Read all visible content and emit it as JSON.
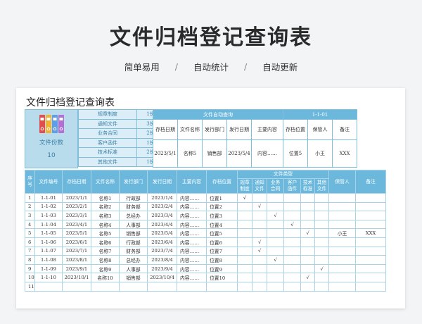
{
  "hero_title": "文件归档登记查询表",
  "subtitle": {
    "items": [
      "简单易用",
      "自动统计",
      "自动更新"
    ],
    "sep": "/"
  },
  "sheet_title": "文件归档登记查询表",
  "count_box": {
    "label": "文件份数",
    "value": "10",
    "binder_colors": [
      "#e04e4e",
      "#f2b233",
      "#5f9ee6",
      "#b46fd6"
    ]
  },
  "categories": [
    {
      "name": "规章制度",
      "count": "1份"
    },
    {
      "name": "通知文件",
      "count": "3份"
    },
    {
      "name": "业务合同",
      "count": "2份"
    },
    {
      "name": "客户函件",
      "count": "1份"
    },
    {
      "name": "技术标准",
      "count": "2份"
    },
    {
      "name": "其他文件",
      "count": "1份"
    }
  ],
  "query": {
    "title": "文件自动查询",
    "key": "1-1-01",
    "headers": [
      "存档日期",
      "文件名称",
      "发行部门",
      "发行日期",
      "主要内容",
      "存档位置",
      "保管人",
      "备注"
    ],
    "values": [
      "2023/5/1",
      "名称5",
      "销售部",
      "2023/5/4",
      "内容……",
      "位置5",
      "小王",
      "XXX"
    ]
  },
  "main": {
    "headers": [
      "序号",
      "文件编号",
      "存档日期",
      "文件名称",
      "发行部门",
      "发行日期",
      "主要内容",
      "存档位置",
      "文件类型",
      "保管人",
      "备注"
    ],
    "type_headers": [
      [
        "规章",
        "制度"
      ],
      [
        "通知",
        "文件"
      ],
      [
        "业务",
        "合同"
      ],
      [
        "客户",
        "函件"
      ],
      [
        "技术",
        "标准"
      ],
      [
        "其他",
        "文件"
      ]
    ],
    "check_mark": "√",
    "rows": [
      {
        "idx": "1",
        "code": "1-1-01",
        "date": "2023/1/1",
        "name": "名称1",
        "dept": "行政部",
        "issue": "2023/1/4",
        "content": "内容……",
        "loc": "位置1",
        "type": 0,
        "keeper": "",
        "note": ""
      },
      {
        "idx": "2",
        "code": "1-1-02",
        "date": "2023/2/1",
        "name": "名称2",
        "dept": "财务部",
        "issue": "2023/2/4",
        "content": "内容……",
        "loc": "位置2",
        "type": 1,
        "keeper": "",
        "note": ""
      },
      {
        "idx": "3",
        "code": "1-1-03",
        "date": "2023/3/1",
        "name": "名称3",
        "dept": "总经办",
        "issue": "2023/3/4",
        "content": "内容……",
        "loc": "位置3",
        "type": 2,
        "keeper": "",
        "note": ""
      },
      {
        "idx": "4",
        "code": "1-1-04",
        "date": "2023/4/1",
        "name": "名称4",
        "dept": "人事部",
        "issue": "2023/4/4",
        "content": "内容……",
        "loc": "位置4",
        "type": 3,
        "keeper": "",
        "note": ""
      },
      {
        "idx": "5",
        "code": "1-1-05",
        "date": "2023/5/1",
        "name": "名称5",
        "dept": "销售部",
        "issue": "2023/5/4",
        "content": "内容……",
        "loc": "位置5",
        "type": 4,
        "keeper": "小王",
        "note": "XXX"
      },
      {
        "idx": "6",
        "code": "1-1-06",
        "date": "2023/6/1",
        "name": "名称6",
        "dept": "行政部",
        "issue": "2023/6/4",
        "content": "内容……",
        "loc": "位置6",
        "type": 1,
        "keeper": "",
        "note": ""
      },
      {
        "idx": "7",
        "code": "1-1-07",
        "date": "2023/7/1",
        "name": "名称7",
        "dept": "财务部",
        "issue": "2023/7/4",
        "content": "内容……",
        "loc": "位置7",
        "type": 1,
        "keeper": "",
        "note": ""
      },
      {
        "idx": "8",
        "code": "1-1-08",
        "date": "2023/8/1",
        "name": "名称8",
        "dept": "总经办",
        "issue": "2023/8/4",
        "content": "内容……",
        "loc": "位置8",
        "type": 2,
        "keeper": "",
        "note": ""
      },
      {
        "idx": "9",
        "code": "1-1-09",
        "date": "2023/9/1",
        "name": "名称9",
        "dept": "人事部",
        "issue": "2023/9/4",
        "content": "内容……",
        "loc": "位置9",
        "type": 5,
        "keeper": "",
        "note": ""
      },
      {
        "idx": "10",
        "code": "1-1-10",
        "date": "2023/10/1",
        "name": "名称10",
        "dept": "销售部",
        "issue": "2023/10/4",
        "content": "内容……",
        "loc": "位置10",
        "type": 4,
        "keeper": "",
        "note": ""
      },
      {
        "idx": "11",
        "code": "",
        "date": "",
        "name": "",
        "dept": "",
        "issue": "",
        "content": "",
        "loc": "",
        "type": -1,
        "keeper": "",
        "note": ""
      }
    ]
  }
}
